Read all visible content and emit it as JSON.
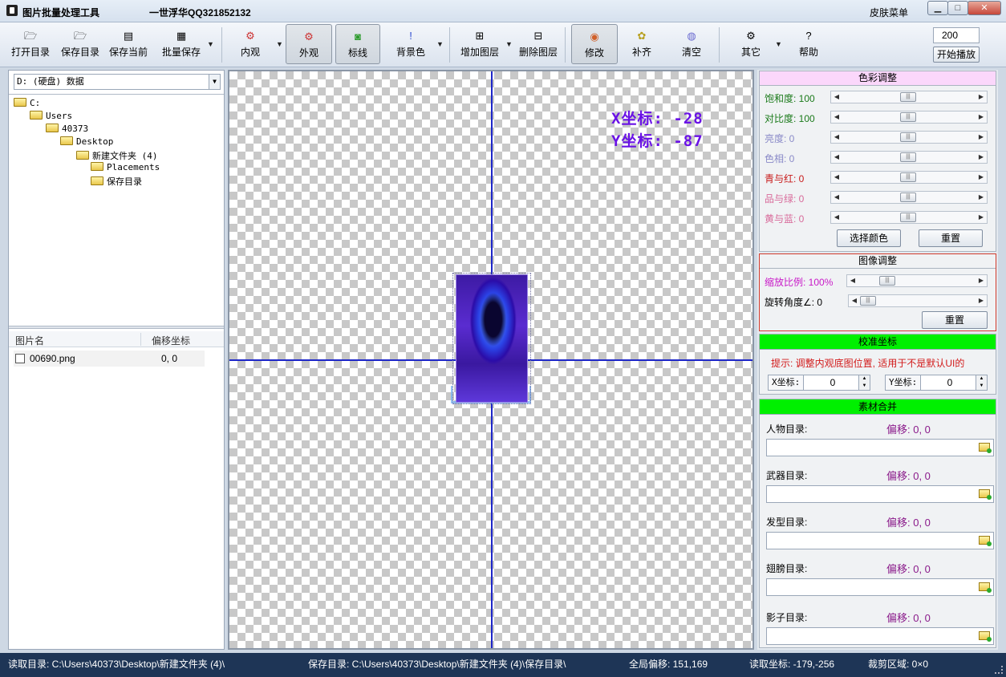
{
  "window": {
    "title": "图片批量处理工具",
    "author": "一世浮华QQ321852132",
    "skin_menu": "皮肤菜单",
    "controls": [
      "0",
      "1",
      "r"
    ]
  },
  "toolbar": {
    "open_dir": "打开目录",
    "save_dir": "保存目录",
    "save_current": "保存当前",
    "batch_save": "批量保存",
    "inner_view": "内观",
    "outer_view": "外观",
    "mark_line": "标线",
    "bg_color": "背景色",
    "add_layer": "增加图层",
    "delete_layer": "删除图层",
    "modify": "修改",
    "fill": "补齐",
    "clear": "清空",
    "other": "其它",
    "help": "帮助",
    "play_value": "200",
    "play_button": "开始播放"
  },
  "file_browser": {
    "drive": "D: (硬盘) 数据",
    "tree": [
      {
        "label": "C:",
        "depth": 0
      },
      {
        "label": "Users",
        "depth": 1
      },
      {
        "label": "40373",
        "depth": 2
      },
      {
        "label": "Desktop",
        "depth": 3
      },
      {
        "label": "新建文件夹 (4)",
        "depth": 4
      },
      {
        "label": "Placements",
        "depth": 5
      },
      {
        "label": "保存目录",
        "depth": 5
      }
    ],
    "list_headers": {
      "name": "图片名",
      "offset": "偏移坐标"
    },
    "files": [
      {
        "name": "00690.png",
        "offset": "0, 0",
        "checked": false
      }
    ]
  },
  "canvas": {
    "x_coord": "X坐标: -28",
    "y_coord": "Y坐标: -87"
  },
  "color_adjust": {
    "title": "色彩调整",
    "sliders": [
      {
        "label": "饱和度: 100",
        "color": "#1a7a1a",
        "value": 0.5
      },
      {
        "label": "对比度: 100",
        "color": "#1a7a1a",
        "value": 0.5
      },
      {
        "label": "亮度: 0",
        "color": "#8a8ac8",
        "value": 0.5
      },
      {
        "label": "色相: 0",
        "color": "#8a8ac8",
        "value": 0.5
      },
      {
        "label": "青与红: 0",
        "color": "#c81a1a",
        "value": 0.5
      },
      {
        "label": "品与绿: 0",
        "color": "#d86a9a",
        "value": 0.5
      },
      {
        "label": "黄与蓝: 0",
        "color": "#d86a9a",
        "value": 0.5
      }
    ],
    "pick_color": "选择颜色",
    "reset": "重置"
  },
  "image_adjust": {
    "title": "图像调整",
    "scale_label": "缩放比例: 100%",
    "rotate_label": "旋转角度∠: 0",
    "reset": "重置"
  },
  "calibrate": {
    "title": "校准坐标",
    "hint": "提示: 调整内观底图位置, 适用于不是默认UI的",
    "x_label": "X坐标:",
    "x_value": "0",
    "y_label": "Y坐标:",
    "y_value": "0"
  },
  "material": {
    "title": "素材合并",
    "items": [
      {
        "label": "人物目录:",
        "offset": "偏移: 0, 0"
      },
      {
        "label": "武器目录:",
        "offset": "偏移: 0, 0"
      },
      {
        "label": "发型目录:",
        "offset": "偏移: 0, 0"
      },
      {
        "label": "翅膀目录:",
        "offset": "偏移: 0, 0"
      },
      {
        "label": "影子目录:",
        "offset": "偏移: 0, 0"
      }
    ]
  },
  "status": {
    "read_dir": "读取目录: C:\\Users\\40373\\Desktop\\新建文件夹 (4)\\",
    "save_dir": "保存目录: C:\\Users\\40373\\Desktop\\新建文件夹 (4)\\保存目录\\",
    "global_offset": "全局偏移: 151,169",
    "read_coord": "读取坐标: -179,-256",
    "crop_area": "裁剪区域: 0×0"
  }
}
